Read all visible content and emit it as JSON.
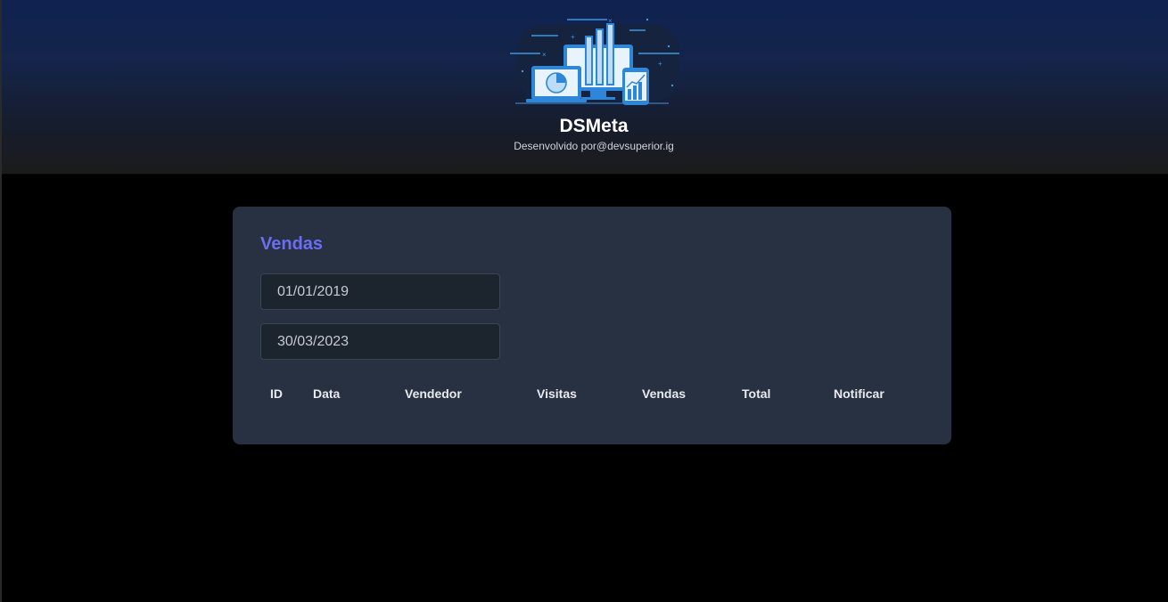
{
  "header": {
    "title": "DSMeta",
    "subtitle": "Desenvolvido por@devsuperior.ig",
    "logo_icon": "dashboard-devices-logo"
  },
  "sales_card": {
    "title": "Vendas",
    "min_date": "01/01/2019",
    "max_date": "30/03/2023",
    "columns": [
      "ID",
      "Data",
      "Vendedor",
      "Visitas",
      "Vendas",
      "Total",
      "Notificar"
    ]
  },
  "colors": {
    "accent": "#6b6df5",
    "card_bg": "#283142",
    "page_bg": "#000000",
    "header_top": "#0f2250"
  }
}
